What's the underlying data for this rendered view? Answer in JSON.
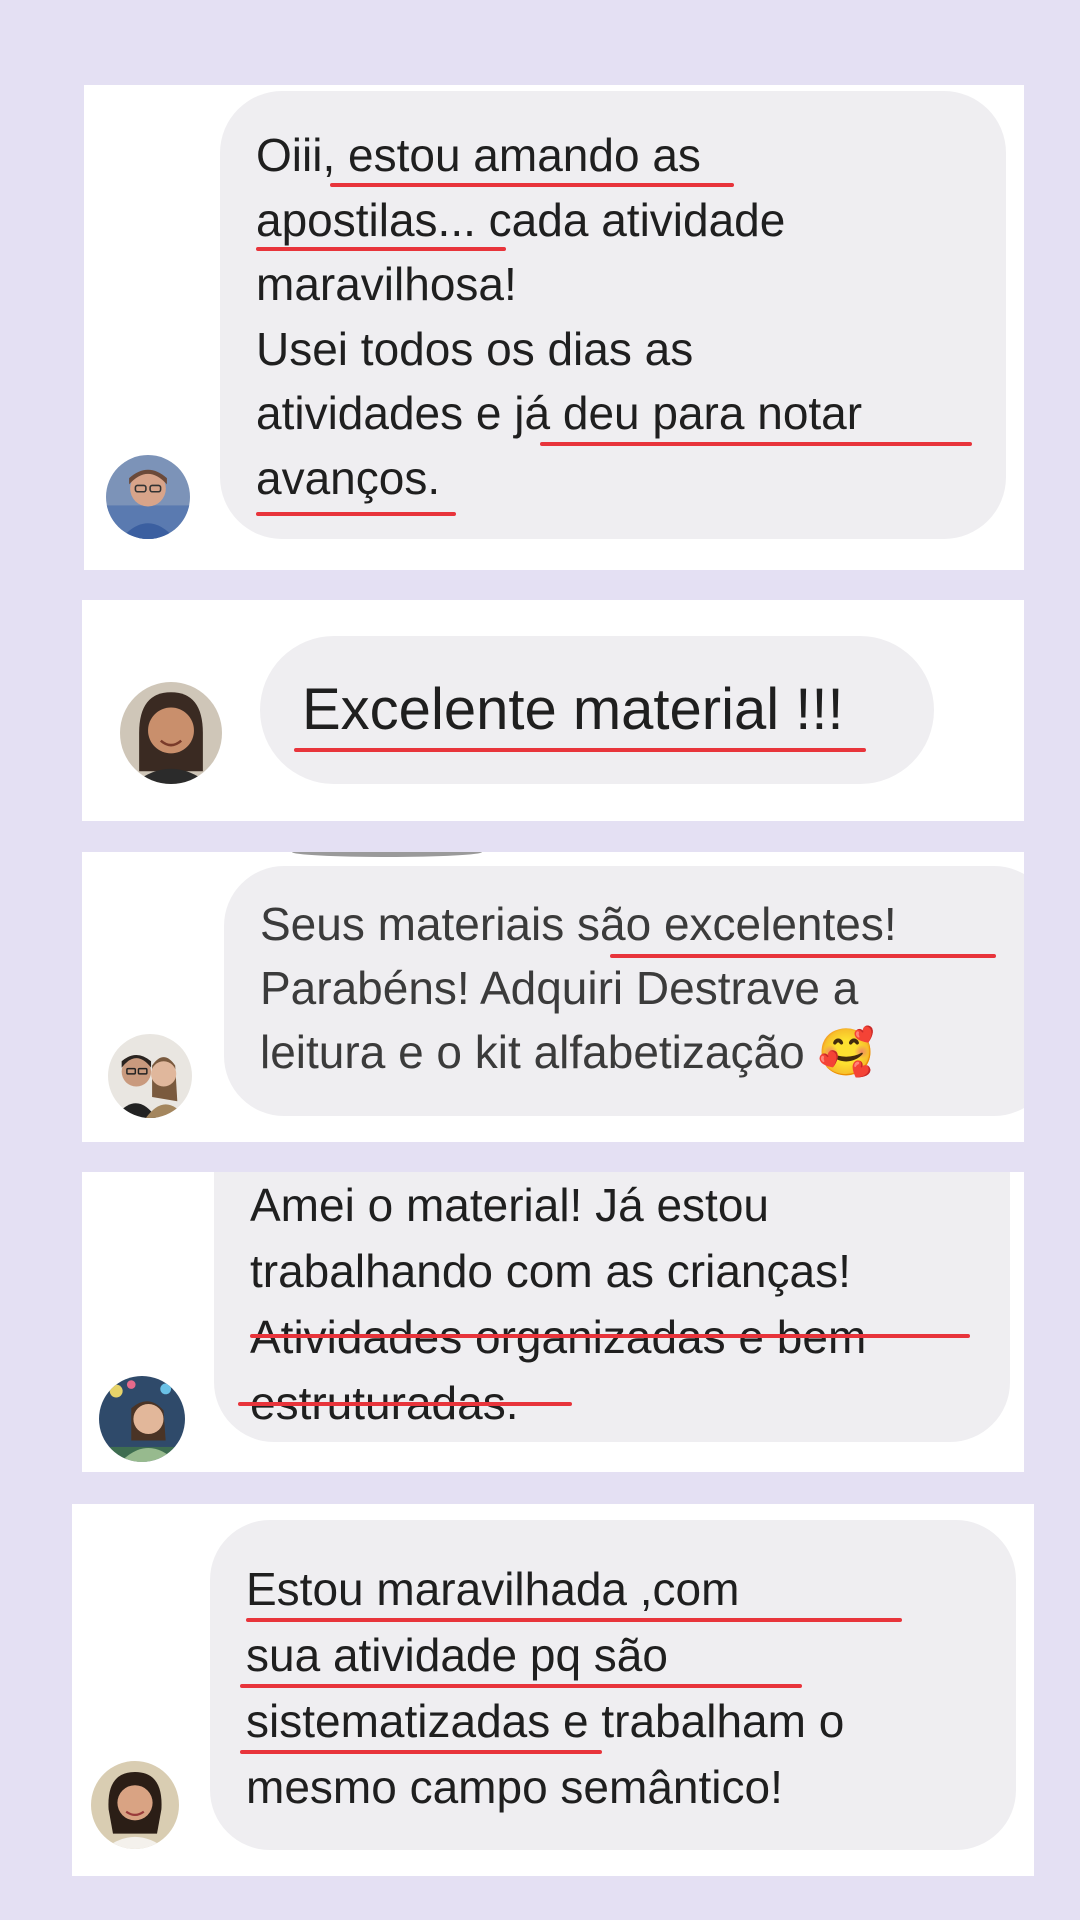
{
  "colors": {
    "background": "#e4e0f3",
    "card": "#ffffff",
    "bubble": "#efeef1",
    "text": "#1f1f1f",
    "underline": "#e8343b"
  },
  "comments": [
    {
      "avatar": "avatar-photo-woman-glasses",
      "text": "Oiii, estou amando as\napostilas... cada atividade\nmaravilhosa!\nUsei todos os dias as\natividades e já  deu para notar\navanços."
    },
    {
      "avatar": "avatar-photo-woman",
      "text": "Excelente material !!!"
    },
    {
      "avatar": "avatar-photo-couple",
      "text": "Seus materiais são excelentes!\nParabéns! Adquiri Destrave a\nleitura e o kit alfabetização",
      "emoji": "🥰"
    },
    {
      "avatar": "avatar-photo-woman-outdoor",
      "text": "Amei o material! Já  estou\ntrabalhando com as crianças!\nAtividades organizadas e bem\nestruturadas."
    },
    {
      "avatar": "avatar-photo-woman-smiling",
      "text": "Estou maravilhada  ,com\nsua atividade pq são\nsistematizadas e trabalham o\nmesmo campo semântico!"
    }
  ]
}
